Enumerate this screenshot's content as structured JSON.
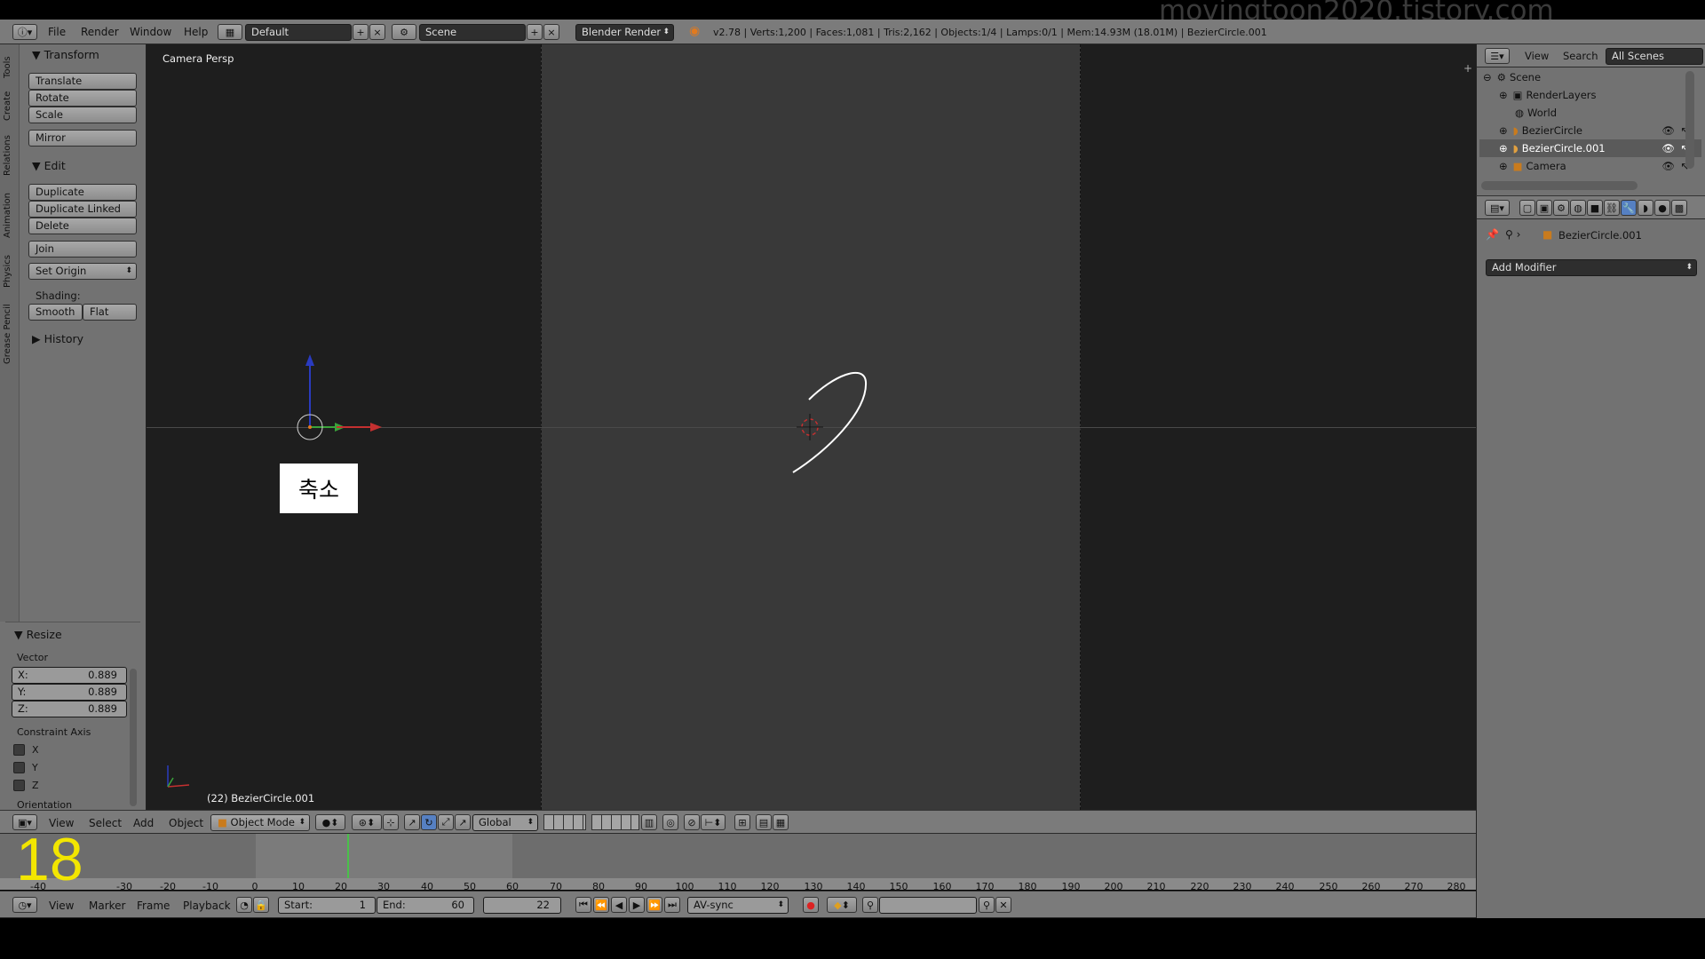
{
  "watermark": "movingtoon2020.tistory.com",
  "top_bar": {
    "menus": [
      "File",
      "Render",
      "Window",
      "Help"
    ],
    "layout": "Default",
    "scene": "Scene",
    "engine": "Blender Render",
    "stats": "v2.78 | Verts:1,200 | Faces:1,081 | Tris:2,162 | Objects:1/4 | Lamps:0/1 | Mem:14.93M (18.01M) | BezierCircle.001"
  },
  "tool_shelf": {
    "tabs": [
      "Tools",
      "Create",
      "Relations",
      "Animation",
      "Physics",
      "Grease Pencil"
    ],
    "transform": {
      "title": "Transform",
      "buttons": [
        "Translate",
        "Rotate",
        "Scale",
        "Mirror"
      ]
    },
    "edit": {
      "title": "Edit",
      "buttons": [
        "Duplicate",
        "Duplicate Linked",
        "Delete",
        "Join"
      ],
      "set_origin": "Set Origin",
      "shading_label": "Shading:",
      "smooth": "Smooth",
      "flat": "Flat"
    },
    "history": {
      "title": "History"
    }
  },
  "operator_panel": {
    "title": "Resize",
    "vector_label": "Vector",
    "x": {
      "label": "X:",
      "value": "0.889"
    },
    "y": {
      "label": "Y:",
      "value": "0.889"
    },
    "z": {
      "label": "Z:",
      "value": "0.889"
    },
    "constraint_label": "Constraint Axis",
    "constraint_x": "X",
    "constraint_y": "Y",
    "constraint_z": "Z",
    "orientation_label": "Orientation"
  },
  "viewport": {
    "view_name": "Camera Persp",
    "object_info": "(22) BezierCircle.001",
    "caption": "축소"
  },
  "view3d_header": {
    "menus": [
      "View",
      "Select",
      "Add",
      "Object"
    ],
    "mode": "Object Mode",
    "orientation": "Global"
  },
  "outliner": {
    "menus": [
      "View",
      "Search"
    ],
    "filter": "All Scenes",
    "items": [
      {
        "label": "Scene"
      },
      {
        "label": "RenderLayers"
      },
      {
        "label": "World"
      },
      {
        "label": "BezierCircle"
      },
      {
        "label": "BezierCircle.001"
      },
      {
        "label": "Camera"
      }
    ]
  },
  "properties": {
    "object_name": "BezierCircle.001",
    "add_modifier": "Add Modifier"
  },
  "timeline": {
    "frame_overlay": "18",
    "ruler": [
      "-40",
      "-30",
      "-20",
      "-10",
      "0",
      "10",
      "20",
      "30",
      "40",
      "50",
      "60",
      "70",
      "80",
      "90",
      "100",
      "110",
      "120",
      "130",
      "140",
      "150",
      "160",
      "170",
      "180",
      "190",
      "200",
      "210",
      "220",
      "230",
      "240",
      "250",
      "260",
      "270",
      "280"
    ],
    "menus": [
      "View",
      "Marker",
      "Frame",
      "Playback"
    ],
    "start_label": "Start:",
    "start_value": "1",
    "end_label": "End:",
    "end_value": "60",
    "current_frame": "22",
    "sync": "AV-sync"
  },
  "colors": {
    "header": "#7b7b7b",
    "panel": "#727272",
    "viewport_dark": "#1e1e1e",
    "viewport_camera": "#393939",
    "selected_text": "#ffffff",
    "axis_x": "#c43030",
    "axis_y": "#3aa33a",
    "axis_z": "#2a3bbf",
    "frame_marker": "#4ac04a",
    "overlay_digit": "#f3e600"
  }
}
